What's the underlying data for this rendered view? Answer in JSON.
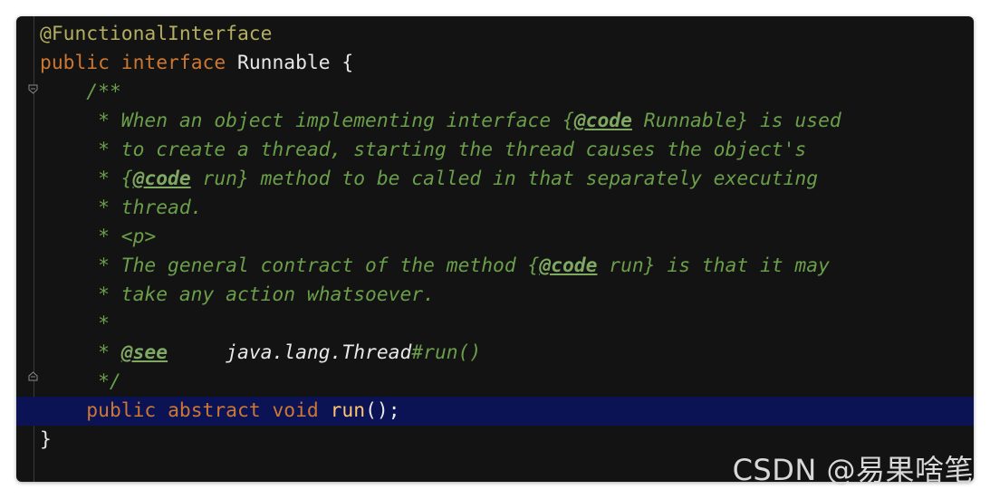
{
  "code": {
    "annotation": "@FunctionalInterface",
    "kw_public": "public",
    "kw_interface": "interface",
    "class_name": "Runnable",
    "open_brace": "{",
    "doc_open": "/**",
    "doc1_pre": "* When an object implementing interface {",
    "doc1_tag": "@code",
    "doc1_post": " Runnable} is used",
    "doc2": "* to create a thread, starting the thread causes the object's",
    "doc3_pre": "* {",
    "doc3_tag": "@code",
    "doc3_post": " run} method to be called in that separately executing",
    "doc4": "* thread.",
    "doc5": "* <p>",
    "doc6_pre": "* The general contract of the method {",
    "doc6_tag": "@code",
    "doc6_post": " run} is that it may",
    "doc7": "* take any action whatsoever.",
    "doc8": "*",
    "doc9_pre": "* ",
    "doc9_tag": "@see",
    "doc9_space": "     ",
    "doc9_ref": "java.lang.Thread",
    "doc9_member": "#run()",
    "doc_close": "*/",
    "kw_abstract": "abstract",
    "kw_void": "void",
    "method_name": "run",
    "method_tail": "();",
    "close_brace": "}"
  },
  "watermark": "CSDN @易果啥笔"
}
